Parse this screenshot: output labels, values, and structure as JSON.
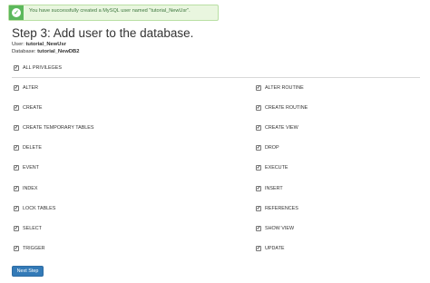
{
  "alert": {
    "message": "You have successfully created a MySQL user named \"tutorial_NewUsr\"."
  },
  "title": "Step 3: Add user to the database.",
  "meta": {
    "user_label": "User:",
    "user_value": "tutorial_NewUsr",
    "db_label": "Database:",
    "db_value": "tutorial_NewDB2"
  },
  "all_privileges": {
    "label": "ALL PRIVILEGES",
    "checked": true
  },
  "privileges": {
    "left": [
      {
        "label": "ALTER",
        "checked": true
      },
      {
        "label": "CREATE",
        "checked": true
      },
      {
        "label": "CREATE TEMPORARY TABLES",
        "checked": true
      },
      {
        "label": "DELETE",
        "checked": true
      },
      {
        "label": "EVENT",
        "checked": true
      },
      {
        "label": "INDEX",
        "checked": true
      },
      {
        "label": "LOCK TABLES",
        "checked": true
      },
      {
        "label": "SELECT",
        "checked": true
      },
      {
        "label": "TRIGGER",
        "checked": true
      }
    ],
    "right": [
      {
        "label": "ALTER ROUTINE",
        "checked": true
      },
      {
        "label": "CREATE ROUTINE",
        "checked": true
      },
      {
        "label": "CREATE VIEW",
        "checked": true
      },
      {
        "label": "DROP",
        "checked": true
      },
      {
        "label": "EXECUTE",
        "checked": true
      },
      {
        "label": "INSERT",
        "checked": true
      },
      {
        "label": "REFERENCES",
        "checked": true
      },
      {
        "label": "SHOW VIEW",
        "checked": true
      },
      {
        "label": "UPDATE",
        "checked": true
      }
    ]
  },
  "next_button": {
    "label": "Next Step"
  },
  "colors": {
    "success_bg": "#e9f6df",
    "success_icon": "#5cb85c",
    "primary": "#337ab7"
  },
  "icons": {
    "alert": "check-circle-icon",
    "checkbox": "check-icon"
  }
}
